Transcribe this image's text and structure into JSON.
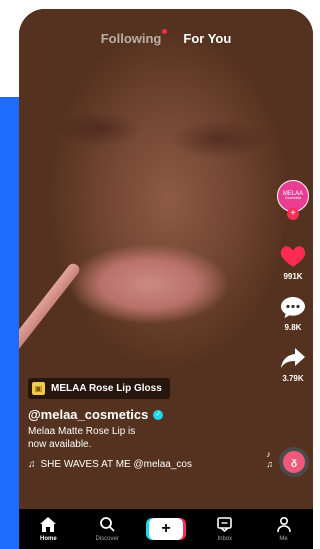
{
  "tabs": {
    "following": "Following",
    "for_you": "For You"
  },
  "profile": {
    "avatar_text": "MELAA",
    "avatar_subtext": "Cosmetics"
  },
  "actions": {
    "likes": "991K",
    "comments": "9.8K",
    "shares": "3.79K"
  },
  "post": {
    "product_tag": "MELAA Rose Lip Gloss",
    "username": "@melaa_cosmetics",
    "description_line1": "Melaa Matte Rose Lip is",
    "description_line2": "now available.",
    "sound": "SHE WAVES AT ME @melaa_cos"
  },
  "nav": {
    "home": "Home",
    "discover": "Discover",
    "inbox": "Inbox",
    "me": "Me"
  },
  "icons": [
    "heart-icon",
    "comment-icon",
    "share-icon",
    "home-icon",
    "search-icon",
    "plus-icon",
    "inbox-icon",
    "profile-icon",
    "music-note-icon",
    "shopping-bag-icon",
    "verified-icon"
  ],
  "colors": {
    "accent_blue": "#1f6bff",
    "tiktok_red": "#fe2c55",
    "tiktok_cyan": "#20d5ec",
    "avatar_pink": "#e83d93"
  }
}
